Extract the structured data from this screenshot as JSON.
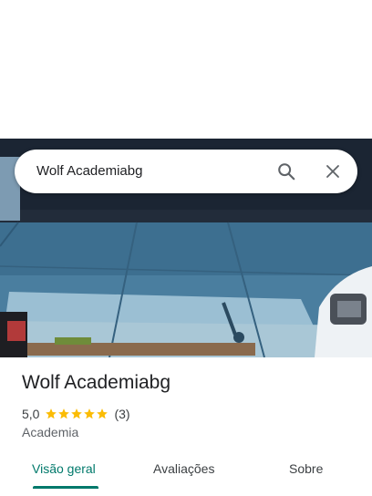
{
  "search": {
    "query": "Wolf Academiabg",
    "search_icon": "search-icon",
    "close_icon": "close-icon"
  },
  "place": {
    "name": "Wolf Academiabg",
    "rating": "5,0",
    "stars": 5,
    "review_count": "(3)",
    "category": "Academia"
  },
  "tabs": [
    {
      "label": "Visão geral",
      "active": true
    },
    {
      "label": "Avaliações",
      "active": false
    },
    {
      "label": "Sobre",
      "active": false
    }
  ],
  "colors": {
    "accent": "#00796b",
    "star": "#fbbc04"
  }
}
